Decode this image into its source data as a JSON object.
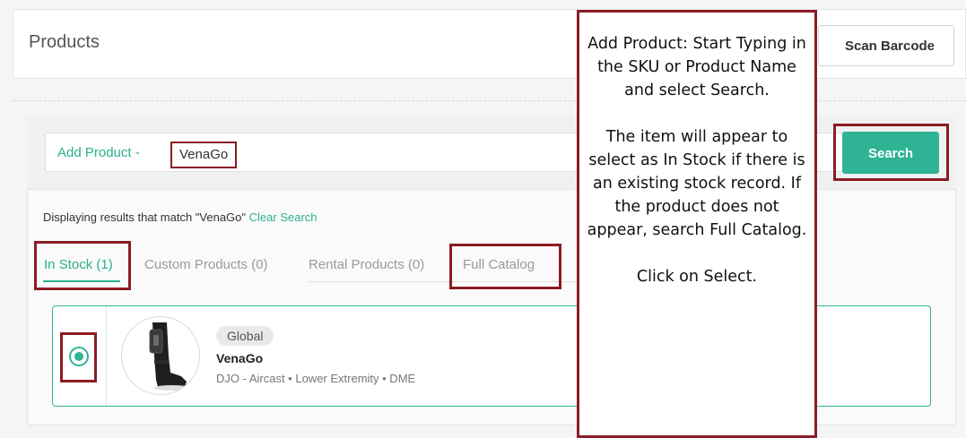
{
  "header": {
    "title": "Products",
    "scan_barcode_label": "Scan Barcode"
  },
  "search": {
    "add_label": "Add Product -",
    "value": "VenaGo",
    "button_label": "Search"
  },
  "results": {
    "message": "Displaying results that match \"VenaGo\"",
    "clear_label": "Clear Search"
  },
  "tabs": [
    {
      "label": "In Stock (1)",
      "active": true
    },
    {
      "label": "Custom Products (0)",
      "active": false
    },
    {
      "label": "Rental Products (0)",
      "active": false
    },
    {
      "label": "Full Catalog",
      "active": false
    }
  ],
  "product": {
    "badge": "Global",
    "name": "VenaGo",
    "meta": "DJO - Aircast • Lower Extremity • DME",
    "selected": true
  },
  "callout": {
    "para1": "Add Product: Start Typing in the SKU or Product Name and select Search.",
    "para2": "The item will appear to select as In Stock if there is an existing stock record. If the product does not appear, search Full Catalog.",
    "para3": "Click on Select."
  },
  "colors": {
    "accent": "#2fb395",
    "annotation_frame": "#8c1c24"
  }
}
